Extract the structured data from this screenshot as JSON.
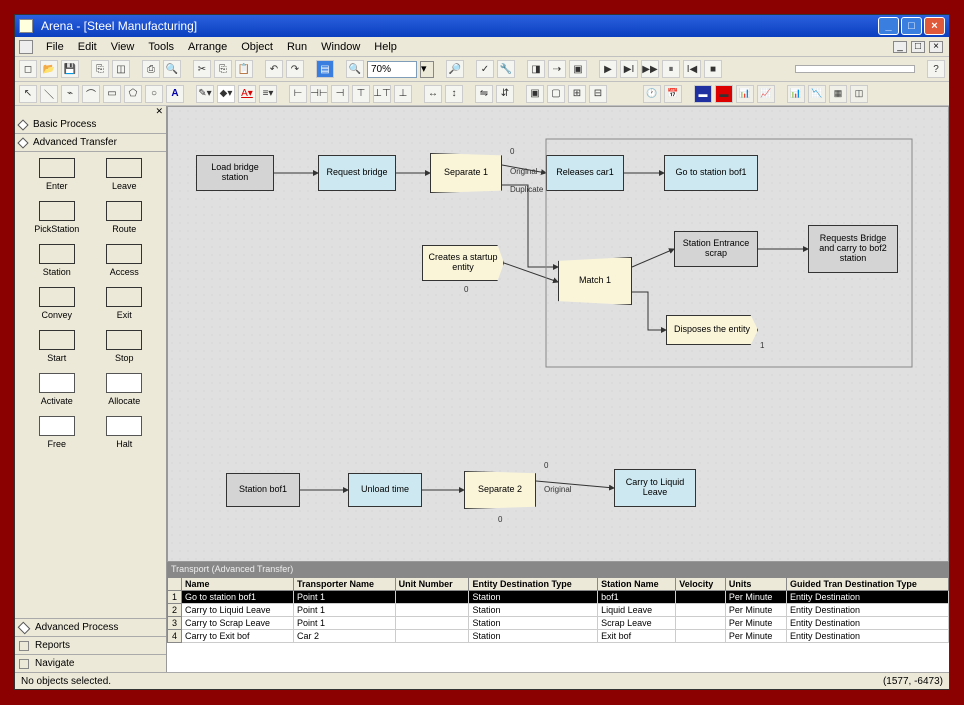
{
  "title": "Arena - [Steel Manufacturing]",
  "menus": [
    "File",
    "Edit",
    "View",
    "Tools",
    "Arrange",
    "Object",
    "Run",
    "Window",
    "Help"
  ],
  "zoom": "70%",
  "sidebar": {
    "sections": [
      {
        "label": "Basic Process"
      },
      {
        "label": "Advanced Transfer"
      }
    ],
    "items": [
      {
        "label": "Enter",
        "filled": true
      },
      {
        "label": "Leave",
        "filled": true
      },
      {
        "label": "PickStation",
        "filled": true
      },
      {
        "label": "Route",
        "filled": true
      },
      {
        "label": "Station",
        "filled": true
      },
      {
        "label": "Access",
        "filled": true
      },
      {
        "label": "Convey",
        "filled": true
      },
      {
        "label": "Exit",
        "filled": true
      },
      {
        "label": "Start",
        "filled": true
      },
      {
        "label": "Stop",
        "filled": true
      },
      {
        "label": "Activate",
        "filled": false
      },
      {
        "label": "Allocate",
        "filled": false
      },
      {
        "label": "Free",
        "filled": false
      },
      {
        "label": "Halt",
        "filled": false
      }
    ],
    "footer": [
      {
        "label": "Advanced Process",
        "type": "d"
      },
      {
        "label": "Reports",
        "type": "i"
      },
      {
        "label": "Navigate",
        "type": "i"
      }
    ]
  },
  "nodes": {
    "loadBridge": "Load bridge station",
    "requestBridge": "Request bridge",
    "separate1": "Separate 1",
    "releasesCar": "Releases car1",
    "goStation": "Go to station bof1",
    "createStartup": "Creates a startup entity",
    "match1": "Match 1",
    "stationEntrance": "Station Entrance scrap",
    "requestsBridge": "Requests Bridge and carry to bof2 station",
    "disposesEntity": "Disposes the entity",
    "stationBof1": "Station bof1",
    "unloadTime": "Unload time",
    "separate2": "Separate 2",
    "carryLiquid": "Carry to Liquid Leave"
  },
  "labels": {
    "original": "Original",
    "duplicate": "Duplicate",
    "zero": "0",
    "one": "1"
  },
  "table": {
    "title": "Transport (Advanced Transfer)",
    "headers": [
      "",
      "Name",
      "Transporter Name",
      "Unit Number",
      "Entity Destination Type",
      "Station Name",
      "Velocity",
      "Units",
      "Guided Tran Destination Type"
    ],
    "rows": [
      {
        "n": "1",
        "sel": true,
        "c": [
          "Go to station bof1",
          "Point 1",
          "",
          "Station",
          "bof1",
          "",
          "Per Minute",
          "Entity Destination"
        ]
      },
      {
        "n": "2",
        "sel": false,
        "c": [
          "Carry to Liquid Leave",
          "Point 1",
          "",
          "Station",
          "Liquid Leave",
          "",
          "Per Minute",
          "Entity Destination"
        ]
      },
      {
        "n": "3",
        "sel": false,
        "c": [
          "Carry to Scrap Leave",
          "Point 1",
          "",
          "Station",
          "Scrap Leave",
          "",
          "Per Minute",
          "Entity Destination"
        ]
      },
      {
        "n": "4",
        "sel": false,
        "c": [
          "Carry to Exit bof",
          "Car 2",
          "",
          "Station",
          "Exit bof",
          "",
          "Per Minute",
          "Entity Destination"
        ]
      }
    ]
  },
  "status": {
    "left": "No objects selected.",
    "right": "(1577, -6473)"
  }
}
